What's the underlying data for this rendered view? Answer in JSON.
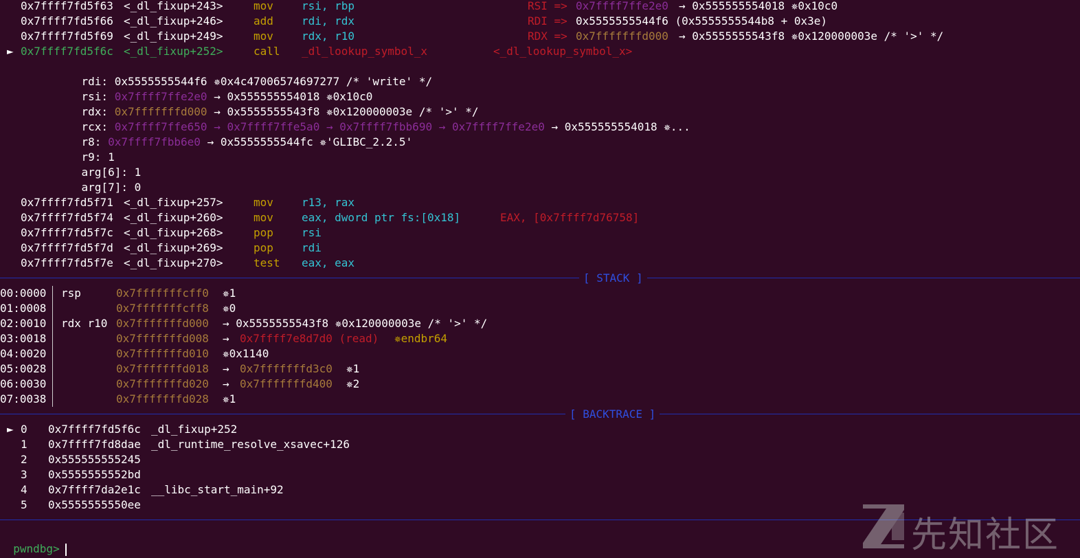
{
  "colors": {
    "background": "#300a24",
    "mnemonic": "#c4a000",
    "register": "#06989a",
    "symbol": "#c01c28",
    "pointer_stack": "#a77b3b",
    "pointer_heap": "#8b2d98",
    "current": "#3fae5a",
    "separator": "#1f2fb0"
  },
  "disasm": {
    "lines": [
      {
        "addr": "0x7ffff7fd5f63",
        "sym": "<_dl_fixup+243>",
        "mnem": "mov",
        "ops": "rsi, rbp",
        "annot_reg": "RSI =>",
        "annot_ptr": "0x7ffff7ffe2e0",
        "annot_rest": "→ 0x555555554018 ✵0x10c0"
      },
      {
        "addr": "0x7ffff7fd5f66",
        "sym": "<_dl_fixup+246>",
        "mnem": "add",
        "ops": "rdi, rdx",
        "annot_reg": "RDI =>",
        "annot_ptr": "",
        "annot_rest": "0x5555555544f6 (0x5555555544b8 + 0x3e)"
      },
      {
        "addr": "0x7ffff7fd5f69",
        "sym": "<_dl_fixup+249>",
        "mnem": "mov",
        "ops": "rdx, r10",
        "annot_reg": "RDX =>",
        "annot_ptr": "0x7fffffffd000",
        "annot_rest": "→ 0x5555555543f8 ✵0x120000003e /* '>' */"
      }
    ],
    "current": {
      "marker": "►",
      "addr": "0x7ffff7fd5f6c",
      "sym": "<_dl_fixup+252>",
      "mnem": "call",
      "target": "_dl_lookup_symbol_x",
      "target_sym": "<_dl_lookup_symbol_x>"
    },
    "args": [
      {
        "name": "rdi:",
        "ptr": "",
        "val": "0x5555555544f6 ✵0x4c47006574697277 /* 'write' */"
      },
      {
        "name": "rsi:",
        "ptr": "0x7ffff7ffe2e0",
        "val": "→ 0x555555554018 ✵0x10c0"
      },
      {
        "name": "rdx:",
        "ptr": "0x7fffffffd000",
        "val": "→ 0x5555555543f8 ✵0x120000003e /* '>' */"
      },
      {
        "name": "rcx:",
        "ptr": "0x7ffff7ffe650 → 0x7ffff7ffe5a0 → 0x7ffff7fbb690 → 0x7ffff7ffe2e0",
        "val": "→ 0x555555554018 ✵..."
      },
      {
        "name": "r8:",
        "ptr": "0x7ffff7fbb6e0",
        "val": "→ 0x5555555544fc ✵'GLIBC_2.2.5'"
      },
      {
        "name": "r9:",
        "ptr": "",
        "val": "1"
      },
      {
        "name": "arg[6]:",
        "ptr": "",
        "val": "1"
      },
      {
        "name": "arg[7]:",
        "ptr": "",
        "val": "0"
      }
    ],
    "after": [
      {
        "addr": "0x7ffff7fd5f71",
        "sym": "<_dl_fixup+257>",
        "mnem": "mov",
        "ops": "r13, rax",
        "annot": ""
      },
      {
        "addr": "0x7ffff7fd5f74",
        "sym": "<_dl_fixup+260>",
        "mnem": "mov",
        "ops": "eax, dword ptr fs:[0x18]",
        "annot": "EAX, [0x7ffff7d76758]"
      },
      {
        "addr": "0x7ffff7fd5f7c",
        "sym": "<_dl_fixup+268>",
        "mnem": "pop",
        "ops": "rsi",
        "annot": ""
      },
      {
        "addr": "0x7ffff7fd5f7d",
        "sym": "<_dl_fixup+269>",
        "mnem": "pop",
        "ops": "rdi",
        "annot": ""
      },
      {
        "addr": "0x7ffff7fd5f7e",
        "sym": "<_dl_fixup+270>",
        "mnem": "test",
        "ops": "eax, eax",
        "annot": ""
      }
    ]
  },
  "stack": {
    "title": "[ STACK ]",
    "rows": [
      {
        "offset": "00:0000",
        "regs": "rsp",
        "addr": "0x7fffffffcff0",
        "chain": "✵1",
        "chain_ptr": "",
        "chain_tail": ""
      },
      {
        "offset": "01:0008",
        "regs": "",
        "addr": "0x7fffffffcff8",
        "chain": "✵0",
        "chain_ptr": "",
        "chain_tail": ""
      },
      {
        "offset": "02:0010",
        "regs": "rdx r10",
        "addr": "0x7fffffffd000",
        "chain": "→ 0x5555555543f8 ✵0x120000003e /* '>' */",
        "chain_ptr": "",
        "chain_tail": ""
      },
      {
        "offset": "03:0018",
        "regs": "",
        "addr": "0x7fffffffd008",
        "chain": "→",
        "chain_ptr": "0x7ffff7e8d7d0 (read)",
        "chain_tail": "✵endbr64"
      },
      {
        "offset": "04:0020",
        "regs": "",
        "addr": "0x7fffffffd010",
        "chain": "✵0x1140",
        "chain_ptr": "",
        "chain_tail": ""
      },
      {
        "offset": "05:0028",
        "regs": "",
        "addr": "0x7fffffffd018",
        "chain": "→",
        "chain_ptr": "0x7fffffffd3c0",
        "chain_tail": "✵1"
      },
      {
        "offset": "06:0030",
        "regs": "",
        "addr": "0x7fffffffd020",
        "chain": "→",
        "chain_ptr": "0x7fffffffd400",
        "chain_tail": "✵2"
      },
      {
        "offset": "07:0038",
        "regs": "",
        "addr": "0x7fffffffd028",
        "chain": "✵1",
        "chain_ptr": "",
        "chain_tail": ""
      }
    ]
  },
  "backtrace": {
    "title": "[ BACKTRACE ]",
    "rows": [
      {
        "marker": "►",
        "idx": "0",
        "addr": "0x7ffff7fd5f6c",
        "sym": "_dl_fixup+252"
      },
      {
        "marker": "",
        "idx": "1",
        "addr": "0x7ffff7fd8dae",
        "sym": "_dl_runtime_resolve_xsavec+126"
      },
      {
        "marker": "",
        "idx": "2",
        "addr": "0x555555555245",
        "sym": ""
      },
      {
        "marker": "",
        "idx": "3",
        "addr": "0x5555555552bd",
        "sym": ""
      },
      {
        "marker": "",
        "idx": "4",
        "addr": "0x7ffff7da2e1c",
        "sym": "__libc_start_main+92"
      },
      {
        "marker": "",
        "idx": "5",
        "addr": "0x5555555550ee",
        "sym": ""
      }
    ]
  },
  "prompt": {
    "text": "pwndbg>"
  },
  "watermark": {
    "text": "先知社区"
  }
}
